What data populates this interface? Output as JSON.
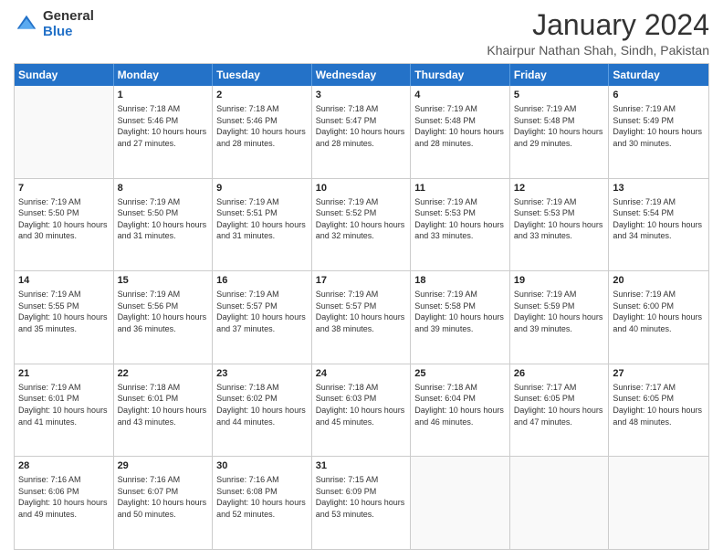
{
  "logo": {
    "general": "General",
    "blue": "Blue"
  },
  "title": "January 2024",
  "location": "Khairpur Nathan Shah, Sindh, Pakistan",
  "header_days": [
    "Sunday",
    "Monday",
    "Tuesday",
    "Wednesday",
    "Thursday",
    "Friday",
    "Saturday"
  ],
  "weeks": [
    [
      {
        "day": "",
        "sunrise": "",
        "sunset": "",
        "daylight": ""
      },
      {
        "day": "1",
        "sunrise": "Sunrise: 7:18 AM",
        "sunset": "Sunset: 5:46 PM",
        "daylight": "Daylight: 10 hours and 27 minutes."
      },
      {
        "day": "2",
        "sunrise": "Sunrise: 7:18 AM",
        "sunset": "Sunset: 5:46 PM",
        "daylight": "Daylight: 10 hours and 28 minutes."
      },
      {
        "day": "3",
        "sunrise": "Sunrise: 7:18 AM",
        "sunset": "Sunset: 5:47 PM",
        "daylight": "Daylight: 10 hours and 28 minutes."
      },
      {
        "day": "4",
        "sunrise": "Sunrise: 7:19 AM",
        "sunset": "Sunset: 5:48 PM",
        "daylight": "Daylight: 10 hours and 28 minutes."
      },
      {
        "day": "5",
        "sunrise": "Sunrise: 7:19 AM",
        "sunset": "Sunset: 5:48 PM",
        "daylight": "Daylight: 10 hours and 29 minutes."
      },
      {
        "day": "6",
        "sunrise": "Sunrise: 7:19 AM",
        "sunset": "Sunset: 5:49 PM",
        "daylight": "Daylight: 10 hours and 30 minutes."
      }
    ],
    [
      {
        "day": "7",
        "sunrise": "Sunrise: 7:19 AM",
        "sunset": "Sunset: 5:50 PM",
        "daylight": "Daylight: 10 hours and 30 minutes."
      },
      {
        "day": "8",
        "sunrise": "Sunrise: 7:19 AM",
        "sunset": "Sunset: 5:50 PM",
        "daylight": "Daylight: 10 hours and 31 minutes."
      },
      {
        "day": "9",
        "sunrise": "Sunrise: 7:19 AM",
        "sunset": "Sunset: 5:51 PM",
        "daylight": "Daylight: 10 hours and 31 minutes."
      },
      {
        "day": "10",
        "sunrise": "Sunrise: 7:19 AM",
        "sunset": "Sunset: 5:52 PM",
        "daylight": "Daylight: 10 hours and 32 minutes."
      },
      {
        "day": "11",
        "sunrise": "Sunrise: 7:19 AM",
        "sunset": "Sunset: 5:53 PM",
        "daylight": "Daylight: 10 hours and 33 minutes."
      },
      {
        "day": "12",
        "sunrise": "Sunrise: 7:19 AM",
        "sunset": "Sunset: 5:53 PM",
        "daylight": "Daylight: 10 hours and 33 minutes."
      },
      {
        "day": "13",
        "sunrise": "Sunrise: 7:19 AM",
        "sunset": "Sunset: 5:54 PM",
        "daylight": "Daylight: 10 hours and 34 minutes."
      }
    ],
    [
      {
        "day": "14",
        "sunrise": "Sunrise: 7:19 AM",
        "sunset": "Sunset: 5:55 PM",
        "daylight": "Daylight: 10 hours and 35 minutes."
      },
      {
        "day": "15",
        "sunrise": "Sunrise: 7:19 AM",
        "sunset": "Sunset: 5:56 PM",
        "daylight": "Daylight: 10 hours and 36 minutes."
      },
      {
        "day": "16",
        "sunrise": "Sunrise: 7:19 AM",
        "sunset": "Sunset: 5:57 PM",
        "daylight": "Daylight: 10 hours and 37 minutes."
      },
      {
        "day": "17",
        "sunrise": "Sunrise: 7:19 AM",
        "sunset": "Sunset: 5:57 PM",
        "daylight": "Daylight: 10 hours and 38 minutes."
      },
      {
        "day": "18",
        "sunrise": "Sunrise: 7:19 AM",
        "sunset": "Sunset: 5:58 PM",
        "daylight": "Daylight: 10 hours and 39 minutes."
      },
      {
        "day": "19",
        "sunrise": "Sunrise: 7:19 AM",
        "sunset": "Sunset: 5:59 PM",
        "daylight": "Daylight: 10 hours and 39 minutes."
      },
      {
        "day": "20",
        "sunrise": "Sunrise: 7:19 AM",
        "sunset": "Sunset: 6:00 PM",
        "daylight": "Daylight: 10 hours and 40 minutes."
      }
    ],
    [
      {
        "day": "21",
        "sunrise": "Sunrise: 7:19 AM",
        "sunset": "Sunset: 6:01 PM",
        "daylight": "Daylight: 10 hours and 41 minutes."
      },
      {
        "day": "22",
        "sunrise": "Sunrise: 7:18 AM",
        "sunset": "Sunset: 6:01 PM",
        "daylight": "Daylight: 10 hours and 43 minutes."
      },
      {
        "day": "23",
        "sunrise": "Sunrise: 7:18 AM",
        "sunset": "Sunset: 6:02 PM",
        "daylight": "Daylight: 10 hours and 44 minutes."
      },
      {
        "day": "24",
        "sunrise": "Sunrise: 7:18 AM",
        "sunset": "Sunset: 6:03 PM",
        "daylight": "Daylight: 10 hours and 45 minutes."
      },
      {
        "day": "25",
        "sunrise": "Sunrise: 7:18 AM",
        "sunset": "Sunset: 6:04 PM",
        "daylight": "Daylight: 10 hours and 46 minutes."
      },
      {
        "day": "26",
        "sunrise": "Sunrise: 7:17 AM",
        "sunset": "Sunset: 6:05 PM",
        "daylight": "Daylight: 10 hours and 47 minutes."
      },
      {
        "day": "27",
        "sunrise": "Sunrise: 7:17 AM",
        "sunset": "Sunset: 6:05 PM",
        "daylight": "Daylight: 10 hours and 48 minutes."
      }
    ],
    [
      {
        "day": "28",
        "sunrise": "Sunrise: 7:16 AM",
        "sunset": "Sunset: 6:06 PM",
        "daylight": "Daylight: 10 hours and 49 minutes."
      },
      {
        "day": "29",
        "sunrise": "Sunrise: 7:16 AM",
        "sunset": "Sunset: 6:07 PM",
        "daylight": "Daylight: 10 hours and 50 minutes."
      },
      {
        "day": "30",
        "sunrise": "Sunrise: 7:16 AM",
        "sunset": "Sunset: 6:08 PM",
        "daylight": "Daylight: 10 hours and 52 minutes."
      },
      {
        "day": "31",
        "sunrise": "Sunrise: 7:15 AM",
        "sunset": "Sunset: 6:09 PM",
        "daylight": "Daylight: 10 hours and 53 minutes."
      },
      {
        "day": "",
        "sunrise": "",
        "sunset": "",
        "daylight": ""
      },
      {
        "day": "",
        "sunrise": "",
        "sunset": "",
        "daylight": ""
      },
      {
        "day": "",
        "sunrise": "",
        "sunset": "",
        "daylight": ""
      }
    ]
  ]
}
